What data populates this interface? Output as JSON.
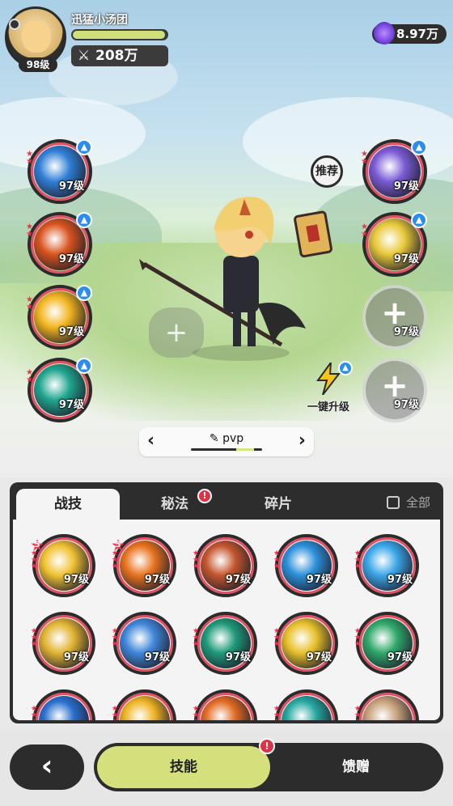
{
  "player": {
    "name": "迅猛小汤团",
    "level": "98级",
    "xp_progress": 0.98,
    "power": "208万"
  },
  "currency": {
    "value": "8.97万",
    "icon": "purple-gem-icon"
  },
  "left_slots": [
    {
      "level": "97级",
      "color": "#2f7fd6",
      "upgradable": true
    },
    {
      "level": "97级",
      "color": "#d9531e",
      "upgradable": true
    },
    {
      "level": "97级",
      "color": "#f2b51f",
      "upgradable": true
    },
    {
      "level": "97级",
      "color": "#1fa58f",
      "upgradable": true
    }
  ],
  "right_slots": [
    {
      "level": "97级",
      "color": "#7b5bd6",
      "upgradable": true,
      "empty": false
    },
    {
      "level": "97级",
      "color": "#e8c83a",
      "upgradable": true,
      "empty": false
    },
    {
      "level": "97级",
      "empty": true
    },
    {
      "level": "97级",
      "empty": true
    }
  ],
  "recommend_label": "推荐",
  "one_click_upgrade_label": "一键升级",
  "preset": {
    "name": "pvp",
    "prev_icon": "chevron-left-icon",
    "next_icon": "chevron-right-icon"
  },
  "tabs": [
    {
      "label": "战技",
      "active": true,
      "alert": false
    },
    {
      "label": "秘法",
      "active": false,
      "alert": true,
      "alert_text": "!"
    },
    {
      "label": "碎片",
      "active": false,
      "alert": false
    }
  ],
  "all_checkbox_label": "全部",
  "skills": [
    {
      "level": "97级",
      "color": "#f1c232",
      "rank": "5"
    },
    {
      "level": "97级",
      "color": "#e8721e",
      "rank": "5"
    },
    {
      "level": "97级",
      "color": "#c4552d",
      "rank": ""
    },
    {
      "level": "97级",
      "color": "#2b8fd9",
      "rank": ""
    },
    {
      "level": "97级",
      "color": "#3aa6e8",
      "rank": ""
    },
    {
      "level": "97级",
      "color": "#e2b432",
      "rank": ""
    },
    {
      "level": "97级",
      "color": "#3f86d8",
      "rank": ""
    },
    {
      "level": "97级",
      "color": "#1f9a7a",
      "rank": ""
    },
    {
      "level": "97级",
      "color": "#e7c02a",
      "rank": ""
    },
    {
      "level": "97级",
      "color": "#2fa86a",
      "rank": ""
    },
    {
      "level": "",
      "color": "#2a6fcf",
      "rank": ""
    },
    {
      "level": "",
      "color": "#f0b423",
      "rank": ""
    },
    {
      "level": "",
      "color": "#e26a22",
      "rank": ""
    },
    {
      "level": "",
      "color": "#25a7a0",
      "rank": ""
    },
    {
      "level": "",
      "color": "#c7a07a",
      "rank": ""
    }
  ],
  "bottom_nav": {
    "back_icon": "chevron-left-icon",
    "items": [
      {
        "label": "技能",
        "active": true,
        "alert": true,
        "alert_text": "!"
      },
      {
        "label": "馈赠",
        "active": false,
        "alert": false
      }
    ]
  },
  "colors": {
    "accent": "#d5e07c",
    "slot_ring": "#e64e62",
    "alert": "#e03246",
    "upgrade": "#2a8ef0"
  }
}
